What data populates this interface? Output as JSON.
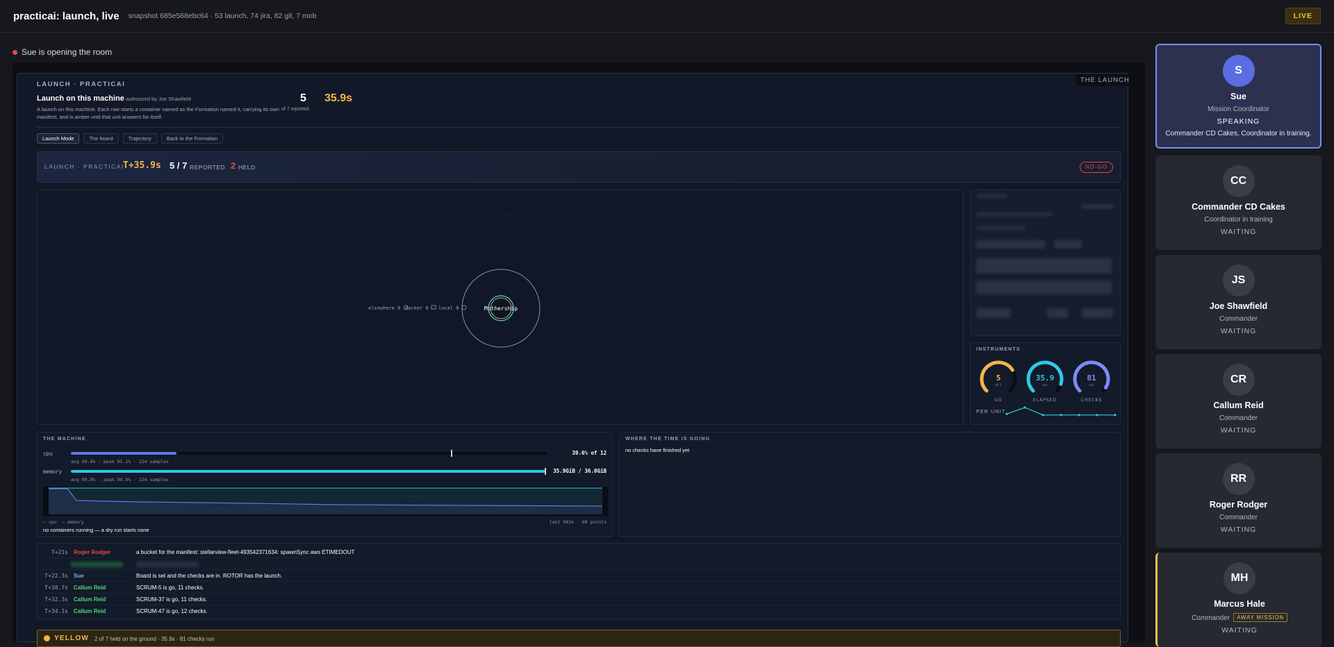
{
  "app": {
    "title": "practicai: launch, live",
    "snapshot": "snapshot 685e568ebc64 · 53 launch, 74 jira, 82 git, 7 mob",
    "live_badge": "LIVE"
  },
  "status": {
    "text": "Sue is opening the room"
  },
  "launch": {
    "corner_tag": "THE LAUNCH",
    "kicker": "LAUNCH · PRACTICAI",
    "title": "Launch on this machine",
    "authorized": "authorized by Joe Shawfield",
    "description": "A launch on this machine. Each row starts a container named as the Formation named it, carrying its own manifest, and is amber until that unit answers for itself.",
    "count": "5",
    "count_sub": "of 7 reported",
    "elapsed": "35.9s",
    "tabs": [
      "Launch Mode",
      "The board",
      "Trajectory",
      "Back to the Formation"
    ],
    "active_tab": 0
  },
  "status_bar": {
    "kicker": "LAUNCH · PRACTICAI",
    "t_plus": "T+35.9s",
    "reported": "5 / 7",
    "reported_label": "REPORTED",
    "held": "2",
    "held_label": "HELD",
    "verdict": "NO-GO"
  },
  "orbit": {
    "center": "Mothership",
    "rings": [
      "elsewhere 0",
      "docker 0",
      "local 0"
    ]
  },
  "instruments": {
    "label": "INSTRUMENTS",
    "gauges": [
      {
        "value": "5",
        "sub": "of 7",
        "label": "GO",
        "color": "#f5b54a",
        "fraction": 0.714
      },
      {
        "value": "35.9",
        "sub": "sec",
        "label": "ELAPSED",
        "color": "#2ec8e8",
        "fraction": 0.9
      },
      {
        "value": "81",
        "sub": "run",
        "label": "CHECKS",
        "color": "#7b8cf6",
        "fraction": 0.95
      }
    ],
    "per_unit_label": "PER UNIT",
    "per_unit_values": [
      5,
      11,
      4,
      4,
      4,
      4,
      4
    ]
  },
  "machine": {
    "label": "THE MACHINE",
    "cpu": {
      "name": "cpu",
      "reading": "39.6% of 12",
      "stats": "avg 49.6% · peak 95.1% · 124 samples",
      "fraction": 0.396,
      "peak": 0.951
    },
    "memory": {
      "name": "memory",
      "reading": "35.9GiB / 36.0GiB",
      "stats": "avg 99.8% · peak 99.9% · 124 samples",
      "fraction": 0.997,
      "peak": 0.999
    },
    "legend_cpu": "— cpu",
    "legend_memory": "— memory",
    "window": "last 983s · 60 points",
    "note": "no containers running — a dry run starts none"
  },
  "where_time": {
    "label": "WHERE THE TIME IS GOING",
    "note": "no checks have finished yet"
  },
  "log": [
    {
      "time": "T+21s",
      "who": "Roger Rodger",
      "who_color": "#e5484d",
      "msg": "a bucket for the manifest: stellarview-fleet-493542371634: spawnSync aws ETIMEDOUT"
    },
    {
      "time": "T+22.3s",
      "who": "Sue",
      "who_color": "#6fb4ff",
      "msg": "Board is set and the checks are in. ROTOR has the launch."
    },
    {
      "time": "T+30.7s",
      "who": "Callum Reid",
      "who_color": "#4cd97b",
      "msg": "SCRUM-5 is go, 11 checks."
    },
    {
      "time": "T+32.3s",
      "who": "Callum Reid",
      "who_color": "#4cd97b",
      "msg": "SCRUM-37 is go, 11 checks."
    },
    {
      "time": "T+34.1s",
      "who": "Callum Reid",
      "who_color": "#4cd97b",
      "msg": "SCRUM-47 is go, 12 checks."
    }
  ],
  "banner": {
    "word": "YELLOW",
    "detail": "2 of 7 held on the ground · 35.9s · 81 checks run"
  },
  "roster": [
    {
      "initials": "S",
      "name": "Sue",
      "role": "Mission Coordinator",
      "status": "SPEAKING",
      "note": "Commander CD Cakes, Coordinator in training.",
      "state": "speaking"
    },
    {
      "initials": "CC",
      "name": "Commander CD Cakes",
      "role": "Coordinator in training",
      "status": "WAITING",
      "state": "waiting"
    },
    {
      "initials": "JS",
      "name": "Joe Shawfield",
      "role": "Commander",
      "status": "WAITING",
      "state": "waiting"
    },
    {
      "initials": "CR",
      "name": "Callum Reid",
      "role": "Commander",
      "status": "WAITING",
      "state": "waiting"
    },
    {
      "initials": "RR",
      "name": "Roger Rodger",
      "role": "Commander",
      "status": "WAITING",
      "state": "waiting"
    },
    {
      "initials": "MH",
      "name": "Marcus Hale",
      "role": "Commander",
      "tag": "AWAY MISSION",
      "status": "WAITING",
      "state": "away"
    }
  ]
}
